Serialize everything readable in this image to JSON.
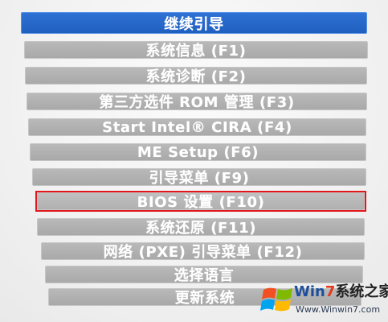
{
  "boot_menu": {
    "items": [
      {
        "label": "继续引导",
        "state": "selected-blue"
      },
      {
        "label": "系统信息 (F1)",
        "state": "normal"
      },
      {
        "label": "系统诊断 (F2)",
        "state": "normal"
      },
      {
        "label": "第三方选件 ROM 管理 (F3)",
        "state": "normal"
      },
      {
        "label": "Start Intel® CIRA (F4)",
        "state": "normal"
      },
      {
        "label": "ME Setup (F6)",
        "state": "normal"
      },
      {
        "label": "引导菜单 (F9)",
        "state": "normal"
      },
      {
        "label": "BIOS 设置 (F10)",
        "state": "highlighted"
      },
      {
        "label": "系统还原 (F11)",
        "state": "normal"
      },
      {
        "label": "网络 (PXE) 引导菜单 (F12)",
        "state": "normal"
      },
      {
        "label": "选择语言",
        "state": "normal"
      },
      {
        "label": "更新系统",
        "state": "normal"
      }
    ]
  },
  "colors": {
    "selected_item": "#2a69cf",
    "normal_item": "#b0b0b0",
    "highlight_border": "#e0171b"
  },
  "watermark": {
    "brand_prefix": "Win",
    "brand_number": "7",
    "brand_suffix": "系统之家",
    "url": "Www.Winwin7.com",
    "icon": "windows-flag-icon"
  }
}
